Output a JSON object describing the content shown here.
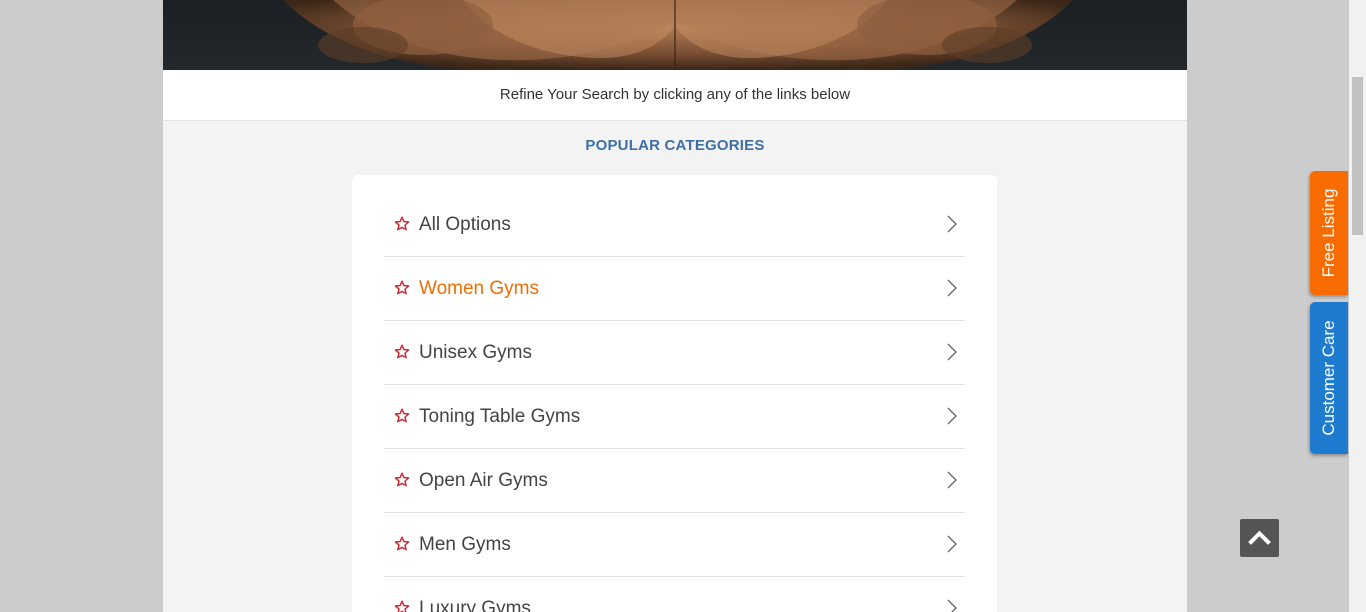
{
  "refine_text": "Refine Your Search by clicking any of the links below",
  "section_title": "POPULAR CATEGORIES",
  "categories": [
    {
      "label": "All Options",
      "active": false
    },
    {
      "label": "Women Gyms",
      "active": true
    },
    {
      "label": "Unisex Gyms",
      "active": false
    },
    {
      "label": "Toning Table Gyms",
      "active": false
    },
    {
      "label": "Open Air Gyms",
      "active": false
    },
    {
      "label": "Men Gyms",
      "active": false
    },
    {
      "label": "Luxury Gyms",
      "active": false
    }
  ],
  "side_tabs": {
    "free_listing": "Free Listing",
    "customer_care": "Customer Care"
  },
  "icons": {
    "category": "star-outline-icon",
    "chevron": "chevron-right-icon",
    "scroll_top": "chevron-up-icon"
  },
  "colors": {
    "accent_orange": "#f86b00",
    "accent_blue": "#1f7bcf",
    "title_blue": "#3d6fa5",
    "star_red": "#d0202e",
    "active_text": "#f26d00"
  }
}
